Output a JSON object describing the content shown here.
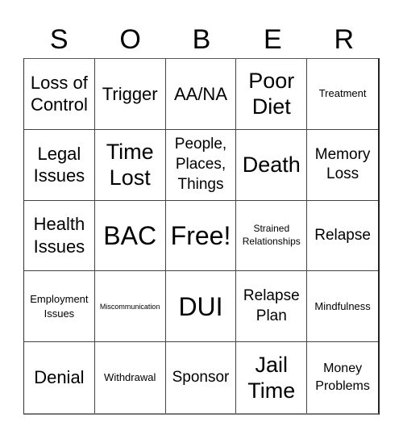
{
  "card": {
    "header_letters": [
      "S",
      "O",
      "B",
      "E",
      "R"
    ],
    "rows": [
      [
        "Loss of Control",
        "Trigger",
        "AA/NA",
        "Poor Diet",
        "Treatment"
      ],
      [
        "Legal Issues",
        "Time Lost",
        "People, Places, Things",
        "Death",
        "Memory Loss"
      ],
      [
        "Health Issues",
        "BAC",
        "Free!",
        "Strained Relationships",
        "Relapse"
      ],
      [
        "Employment Issues",
        "Miscommunication",
        "DUI",
        "Relapse Plan",
        "Mindfulness"
      ],
      [
        "Denial",
        "Withdrawal",
        "Sponsor",
        "Jail Time",
        "Money Problems"
      ]
    ]
  }
}
